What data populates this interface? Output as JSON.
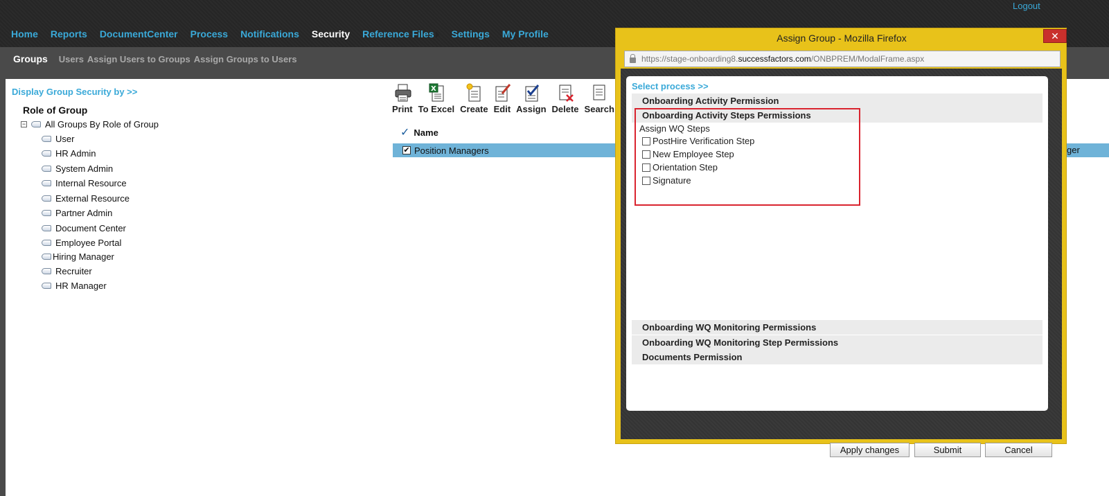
{
  "header": {
    "logout": "Logout",
    "nav": [
      {
        "label": "Home"
      },
      {
        "label": "Reports"
      },
      {
        "label": "DocumentCenter"
      },
      {
        "label": "Process"
      },
      {
        "label": "Notifications"
      },
      {
        "label": "Security",
        "active": true
      },
      {
        "label": "Reference Files"
      },
      {
        "label": "Settings"
      },
      {
        "label": "My Profile"
      }
    ]
  },
  "subnav": [
    {
      "label": "Groups",
      "active": true
    },
    {
      "label": "Users"
    },
    {
      "label": "Assign Users to Groups"
    },
    {
      "label": "Assign Groups to Users"
    }
  ],
  "left_panel": {
    "display_by": "Display Group Security by >>",
    "heading": "Role of Group",
    "root": "All Groups By Role of Group",
    "groups": [
      "User",
      "HR Admin",
      "System Admin",
      "Internal Resource",
      "External Resource",
      "Partner Admin",
      "Document Center",
      "Employee Portal",
      "Hiring Manager",
      "Recruiter",
      "HR Manager"
    ]
  },
  "toolbar": {
    "print": "Print",
    "to_excel": "To Excel",
    "create": "Create",
    "edit": "Edit",
    "assign": "Assign",
    "delete": "Delete",
    "search": "Search"
  },
  "grid": {
    "column_name": "Name",
    "row_name": "Position Managers",
    "row_right": "ger"
  },
  "modal": {
    "title": "Assign Group - Mozilla Firefox",
    "close": "✕",
    "url_prefix": "https://stage-onboarding8.",
    "url_host": "successfactors.com",
    "url_path": "/ONBPREM/ModalFrame.aspx",
    "select_process": "Select process >>",
    "sections": {
      "activity": "Onboarding Activity Permission",
      "activity_steps": "Onboarding Activity Steps Permissions",
      "wq_monitoring": "Onboarding WQ Monitoring Permissions",
      "wq_monitoring_steps": "Onboarding WQ Monitoring Step Permissions",
      "documents": "Documents Permission"
    },
    "assign_wq_label": "Assign WQ Steps",
    "steps": [
      "PostHire Verification Step",
      "New Employee Step",
      "Orientation Step",
      "Signature"
    ],
    "buttons": {
      "apply": "Apply changes",
      "submit": "Submit",
      "cancel": "Cancel"
    }
  },
  "colors": {
    "accent": "#3aa9d8",
    "header_bg": "#2b2b2b",
    "modal_frame": "#e8c21a",
    "highlight_row": "#6fb3d8",
    "red_box": "#d9232e"
  }
}
